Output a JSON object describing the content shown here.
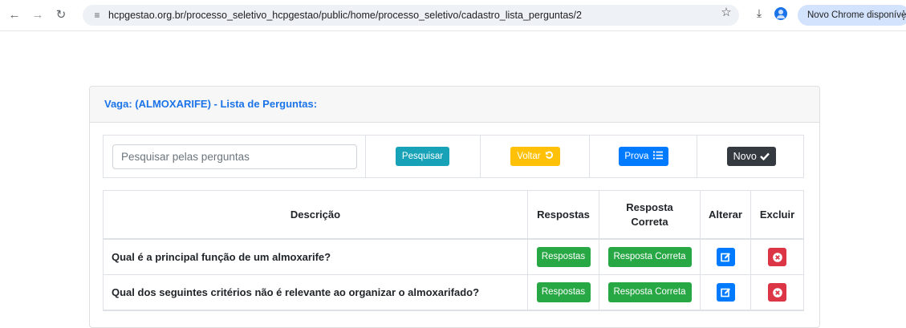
{
  "browser": {
    "url": "hcpgestao.org.br/processo_seletivo_hcpgestao/public/home/processo_seletivo/cadastro_lista_perguntas/2",
    "update_label": "Novo Chrome disponível"
  },
  "card": {
    "title": "Vaga: (ALMOXARIFE) - Lista de Perguntas:"
  },
  "toolbar": {
    "search_placeholder": "Pesquisar pelas perguntas",
    "search_label": "Pesquisar",
    "back_label": "Voltar",
    "test_label": "Prova",
    "new_label": "Novo"
  },
  "table": {
    "headers": {
      "description": "Descrição",
      "answers": "Respostas",
      "correct_answer": "Resposta Correta",
      "edit": "Alterar",
      "delete": "Excluir"
    },
    "rows": [
      {
        "description": "Qual é a principal função de um almoxarife?",
        "answers_label": "Respostas",
        "correct_label": "Resposta Correta"
      },
      {
        "description": "Qual dos seguintes critérios não é relevante ao organizar o almoxarifado?",
        "answers_label": "Respostas",
        "correct_label": "Resposta Correta"
      }
    ]
  },
  "colors": {
    "info": "#17a2b8",
    "warning": "#ffc107",
    "primary": "#007bff",
    "dark": "#343a40",
    "success": "#28a745",
    "danger": "#dc3545",
    "title": "#1a73e8"
  }
}
